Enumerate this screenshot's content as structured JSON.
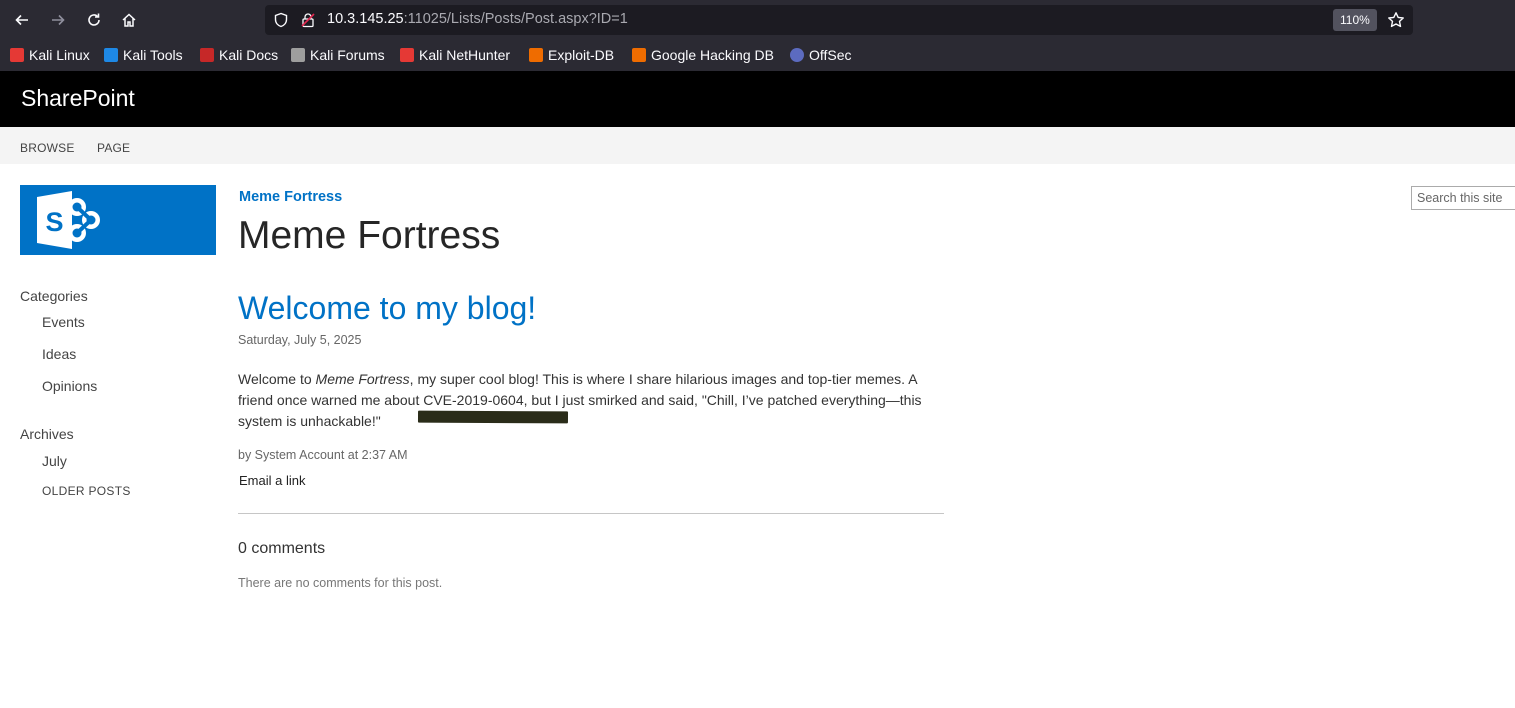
{
  "browser": {
    "url_host": "10.3.145.25",
    "url_rest": ":11025/Lists/Posts/Post.aspx?ID=1",
    "zoom": "110%",
    "bookmarks": [
      {
        "label": "Kali Linux",
        "color": "#e53935"
      },
      {
        "label": "Kali Tools",
        "color": "#1e88e5"
      },
      {
        "label": "Kali Docs",
        "color": "#c62828"
      },
      {
        "label": "Kali Forums",
        "color": "#9e9e9e"
      },
      {
        "label": "Kali NetHunter",
        "color": "#e53935"
      },
      {
        "label": "Exploit-DB",
        "color": "#ef6c00"
      },
      {
        "label": "Google Hacking DB",
        "color": "#ef6c00"
      },
      {
        "label": "OffSec",
        "color": "#5c6bc0"
      }
    ]
  },
  "header": {
    "brand": "SharePoint",
    "tabs": [
      "BROWSE",
      "PAGE"
    ]
  },
  "sidebar": {
    "categories_label": "Categories",
    "categories": [
      "Events",
      "Ideas",
      "Opinions"
    ],
    "archives_label": "Archives",
    "archives": [
      "July"
    ],
    "older_posts": "OLDER POSTS"
  },
  "site": {
    "link": "Meme Fortress",
    "title": "Meme Fortress"
  },
  "search": {
    "placeholder": "Search this site"
  },
  "post": {
    "title": "Welcome to my blog!",
    "date": "Saturday, July 5, 2025",
    "body_pre": "Welcome to ",
    "body_italic": "Meme Fortress",
    "body_post": ", my super cool blog! This is where I share hilarious images and top-tier memes. A friend once warned me about CVE-2019-0604, but I just smirked and said, \"Chill, I’ve patched everything—this system is unhackable!\"",
    "byline": "by System Account at 2:37 AM",
    "email_link": "Email a link"
  },
  "comments": {
    "heading": "0 comments",
    "empty": "There are no comments for this post."
  }
}
